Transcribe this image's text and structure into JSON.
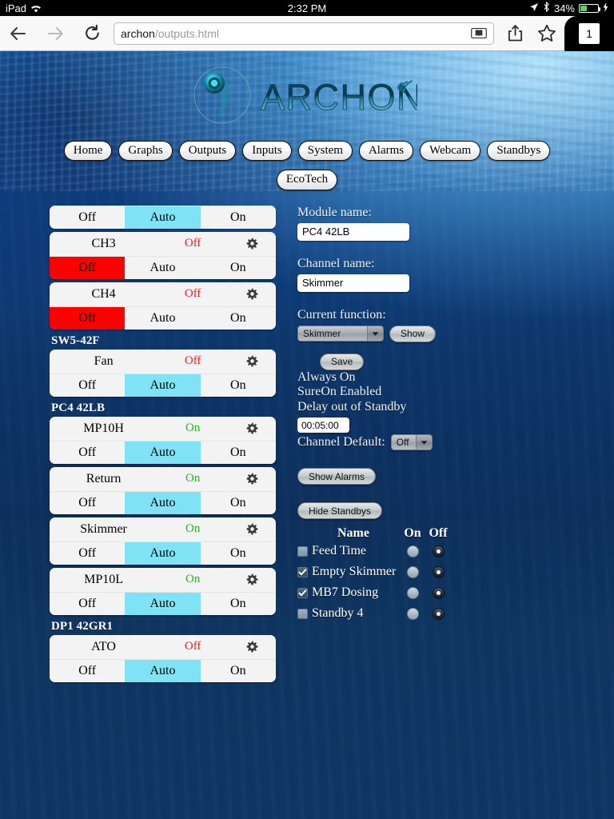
{
  "statusbar": {
    "device": "iPad",
    "wifi_icon": "wifi-icon",
    "time": "2:32 PM",
    "location_icon": "location-arrow-icon",
    "bluetooth_icon": "bluetooth-icon",
    "battery_percent": "34%",
    "charging_icon": "lightning-bolt-icon",
    "battery_fill_color": "#4CD964"
  },
  "browser": {
    "back_icon": "back-arrow-icon",
    "forward_icon": "forward-arrow-icon",
    "reload_icon": "reload-icon",
    "url_host": "archon",
    "url_path": "/outputs.html",
    "reader_icon": "reader-view-icon",
    "share_icon": "share-icon",
    "bookmark_icon": "bookmark-star-icon",
    "tab_count": "1"
  },
  "site": {
    "logo_text": "ARCHON",
    "logo_icon": "archon-logo-icon"
  },
  "nav": {
    "row1": [
      {
        "label": "Home"
      },
      {
        "label": "Graphs"
      },
      {
        "label": "Outputs"
      },
      {
        "label": "Inputs"
      },
      {
        "label": "System"
      },
      {
        "label": "Alarms"
      },
      {
        "label": "Webcam"
      },
      {
        "label": "Standbys"
      }
    ],
    "row2": [
      {
        "label": "EcoTech"
      }
    ]
  },
  "controls": {
    "off_label": "Off",
    "auto_label": "Auto",
    "on_label": "On",
    "gear_icon": "gear-icon",
    "colors": {
      "auto_selected": "#7FE3F5",
      "off_selected": "#FF0000",
      "state_on": "#22b522",
      "state_off": "#e82323"
    }
  },
  "outputs": [
    {
      "type": "card",
      "partial": true,
      "name": "",
      "state": "",
      "selected": "auto"
    },
    {
      "type": "card",
      "partial": false,
      "name": "CH3",
      "state": "Off",
      "state_class": "off",
      "selected": "off"
    },
    {
      "type": "card",
      "partial": false,
      "name": "CH4",
      "state": "Off",
      "state_class": "off",
      "selected": "off"
    },
    {
      "type": "group",
      "label": "SW5-42F"
    },
    {
      "type": "card",
      "partial": false,
      "name": "Fan",
      "state": "Off",
      "state_class": "off",
      "selected": "auto"
    },
    {
      "type": "group",
      "label": "PC4 42LB"
    },
    {
      "type": "card",
      "partial": false,
      "name": "MP10H",
      "state": "On",
      "state_class": "on",
      "selected": "auto"
    },
    {
      "type": "card",
      "partial": false,
      "name": "Return",
      "state": "On",
      "state_class": "on",
      "selected": "auto"
    },
    {
      "type": "card",
      "partial": false,
      "name": "Skimmer",
      "state": "On",
      "state_class": "on",
      "selected": "auto"
    },
    {
      "type": "card",
      "partial": false,
      "name": "MP10L",
      "state": "On",
      "state_class": "on",
      "selected": "auto"
    },
    {
      "type": "group",
      "label": "DP1 42GR1"
    },
    {
      "type": "card",
      "partial": false,
      "name": "ATO",
      "state": "Off",
      "state_class": "off",
      "selected": "auto"
    }
  ],
  "panel": {
    "module_name_label": "Module name:",
    "module_name_value": "PC4 42LB",
    "channel_name_label": "Channel name:",
    "channel_name_value": "Skimmer",
    "current_function_label": "Current function:",
    "current_function_value": "Skimmer",
    "show_button": "Show",
    "save_button": "Save",
    "status_lines": [
      "Always On",
      "SureOn Enabled",
      "Delay out of Standby"
    ],
    "delay_value": "00:05:00",
    "channel_default_label": "Channel Default:",
    "channel_default_value": "Off",
    "show_alarms_button": "Show Alarms",
    "hide_standbys_button": "Hide Standbys",
    "dropdown_arrow_icon": "chevron-down-icon"
  },
  "standbys": {
    "header": {
      "name": "Name",
      "on": "On",
      "off": "Off"
    },
    "rows": [
      {
        "name": "Feed Time",
        "checked": false,
        "on_selected": false,
        "off_selected": true
      },
      {
        "name": "Empty Skimmer",
        "checked": true,
        "on_selected": false,
        "off_selected": true
      },
      {
        "name": "MB7 Dosing",
        "checked": true,
        "on_selected": false,
        "off_selected": true
      },
      {
        "name": "Standby 4",
        "checked": false,
        "on_selected": false,
        "off_selected": true
      }
    ]
  }
}
